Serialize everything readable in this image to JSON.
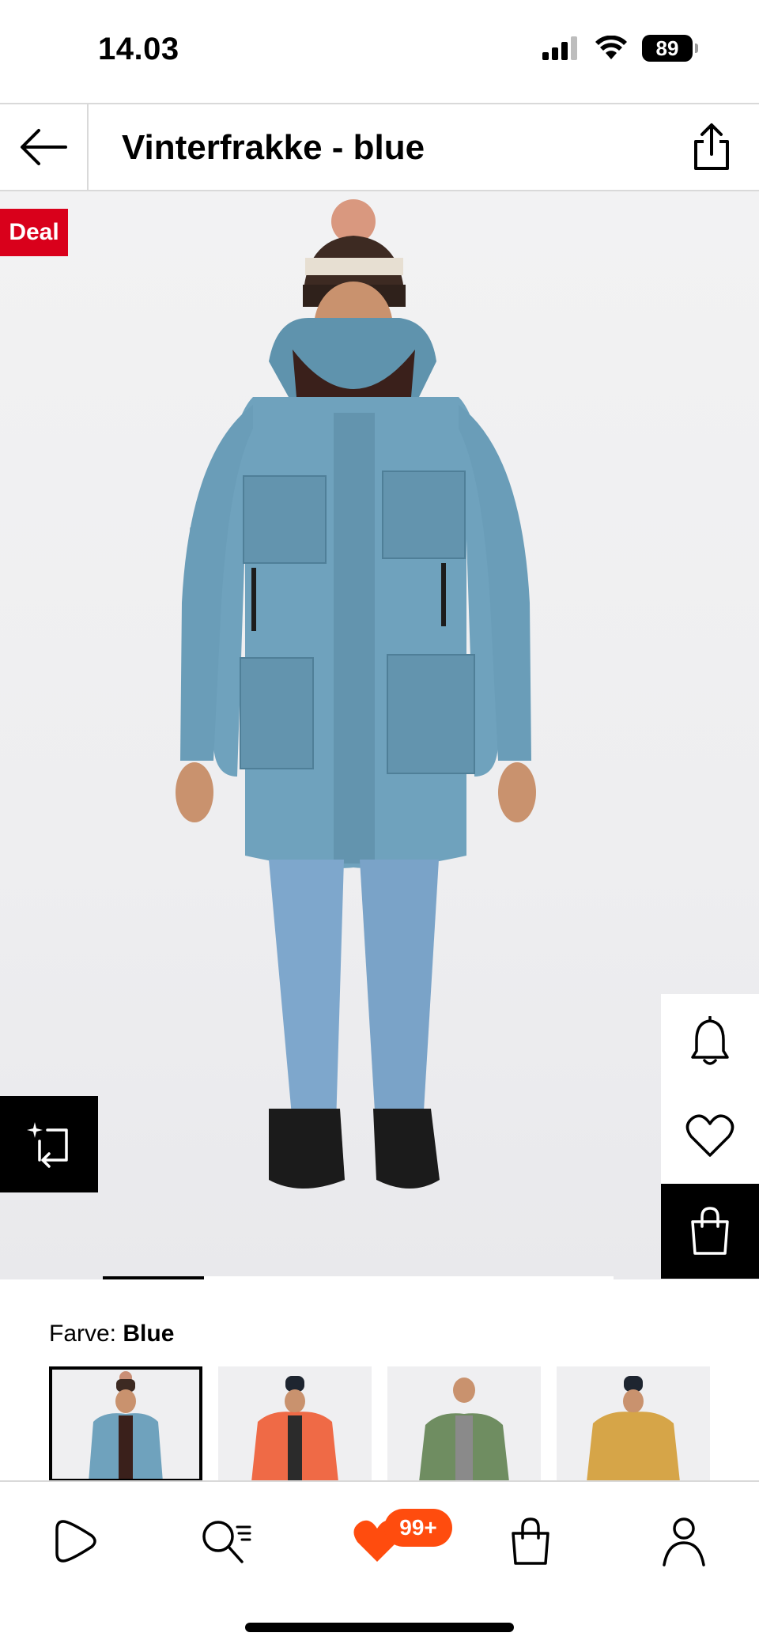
{
  "status_bar": {
    "time": "14.03",
    "battery": "89"
  },
  "header": {
    "title": "Vinterfrakke - blue"
  },
  "hero": {
    "deal_label": "Deal",
    "carousel_position": 0.2
  },
  "color": {
    "label": "Farve:",
    "value": "Blue",
    "swatches": [
      {
        "name": "blue",
        "jacket": "#6fa2bd"
      },
      {
        "name": "orange",
        "jacket": "#ef6a46"
      },
      {
        "name": "green",
        "jacket": "#6f8d61"
      },
      {
        "name": "yellow",
        "jacket": "#d6a548"
      }
    ]
  },
  "bottom_nav": {
    "favorites_badge": "99+"
  },
  "colors": {
    "deal": "#d9001b",
    "badge": "#ff4c0e",
    "heart": "#ff4c0e"
  },
  "icons": [
    "back-arrow-icon",
    "share-icon",
    "bell-icon",
    "heart-icon",
    "shopping-bag-icon",
    "compare-icon",
    "play-icon",
    "search-icon",
    "heart-filled-icon",
    "bag-icon",
    "user-icon"
  ]
}
